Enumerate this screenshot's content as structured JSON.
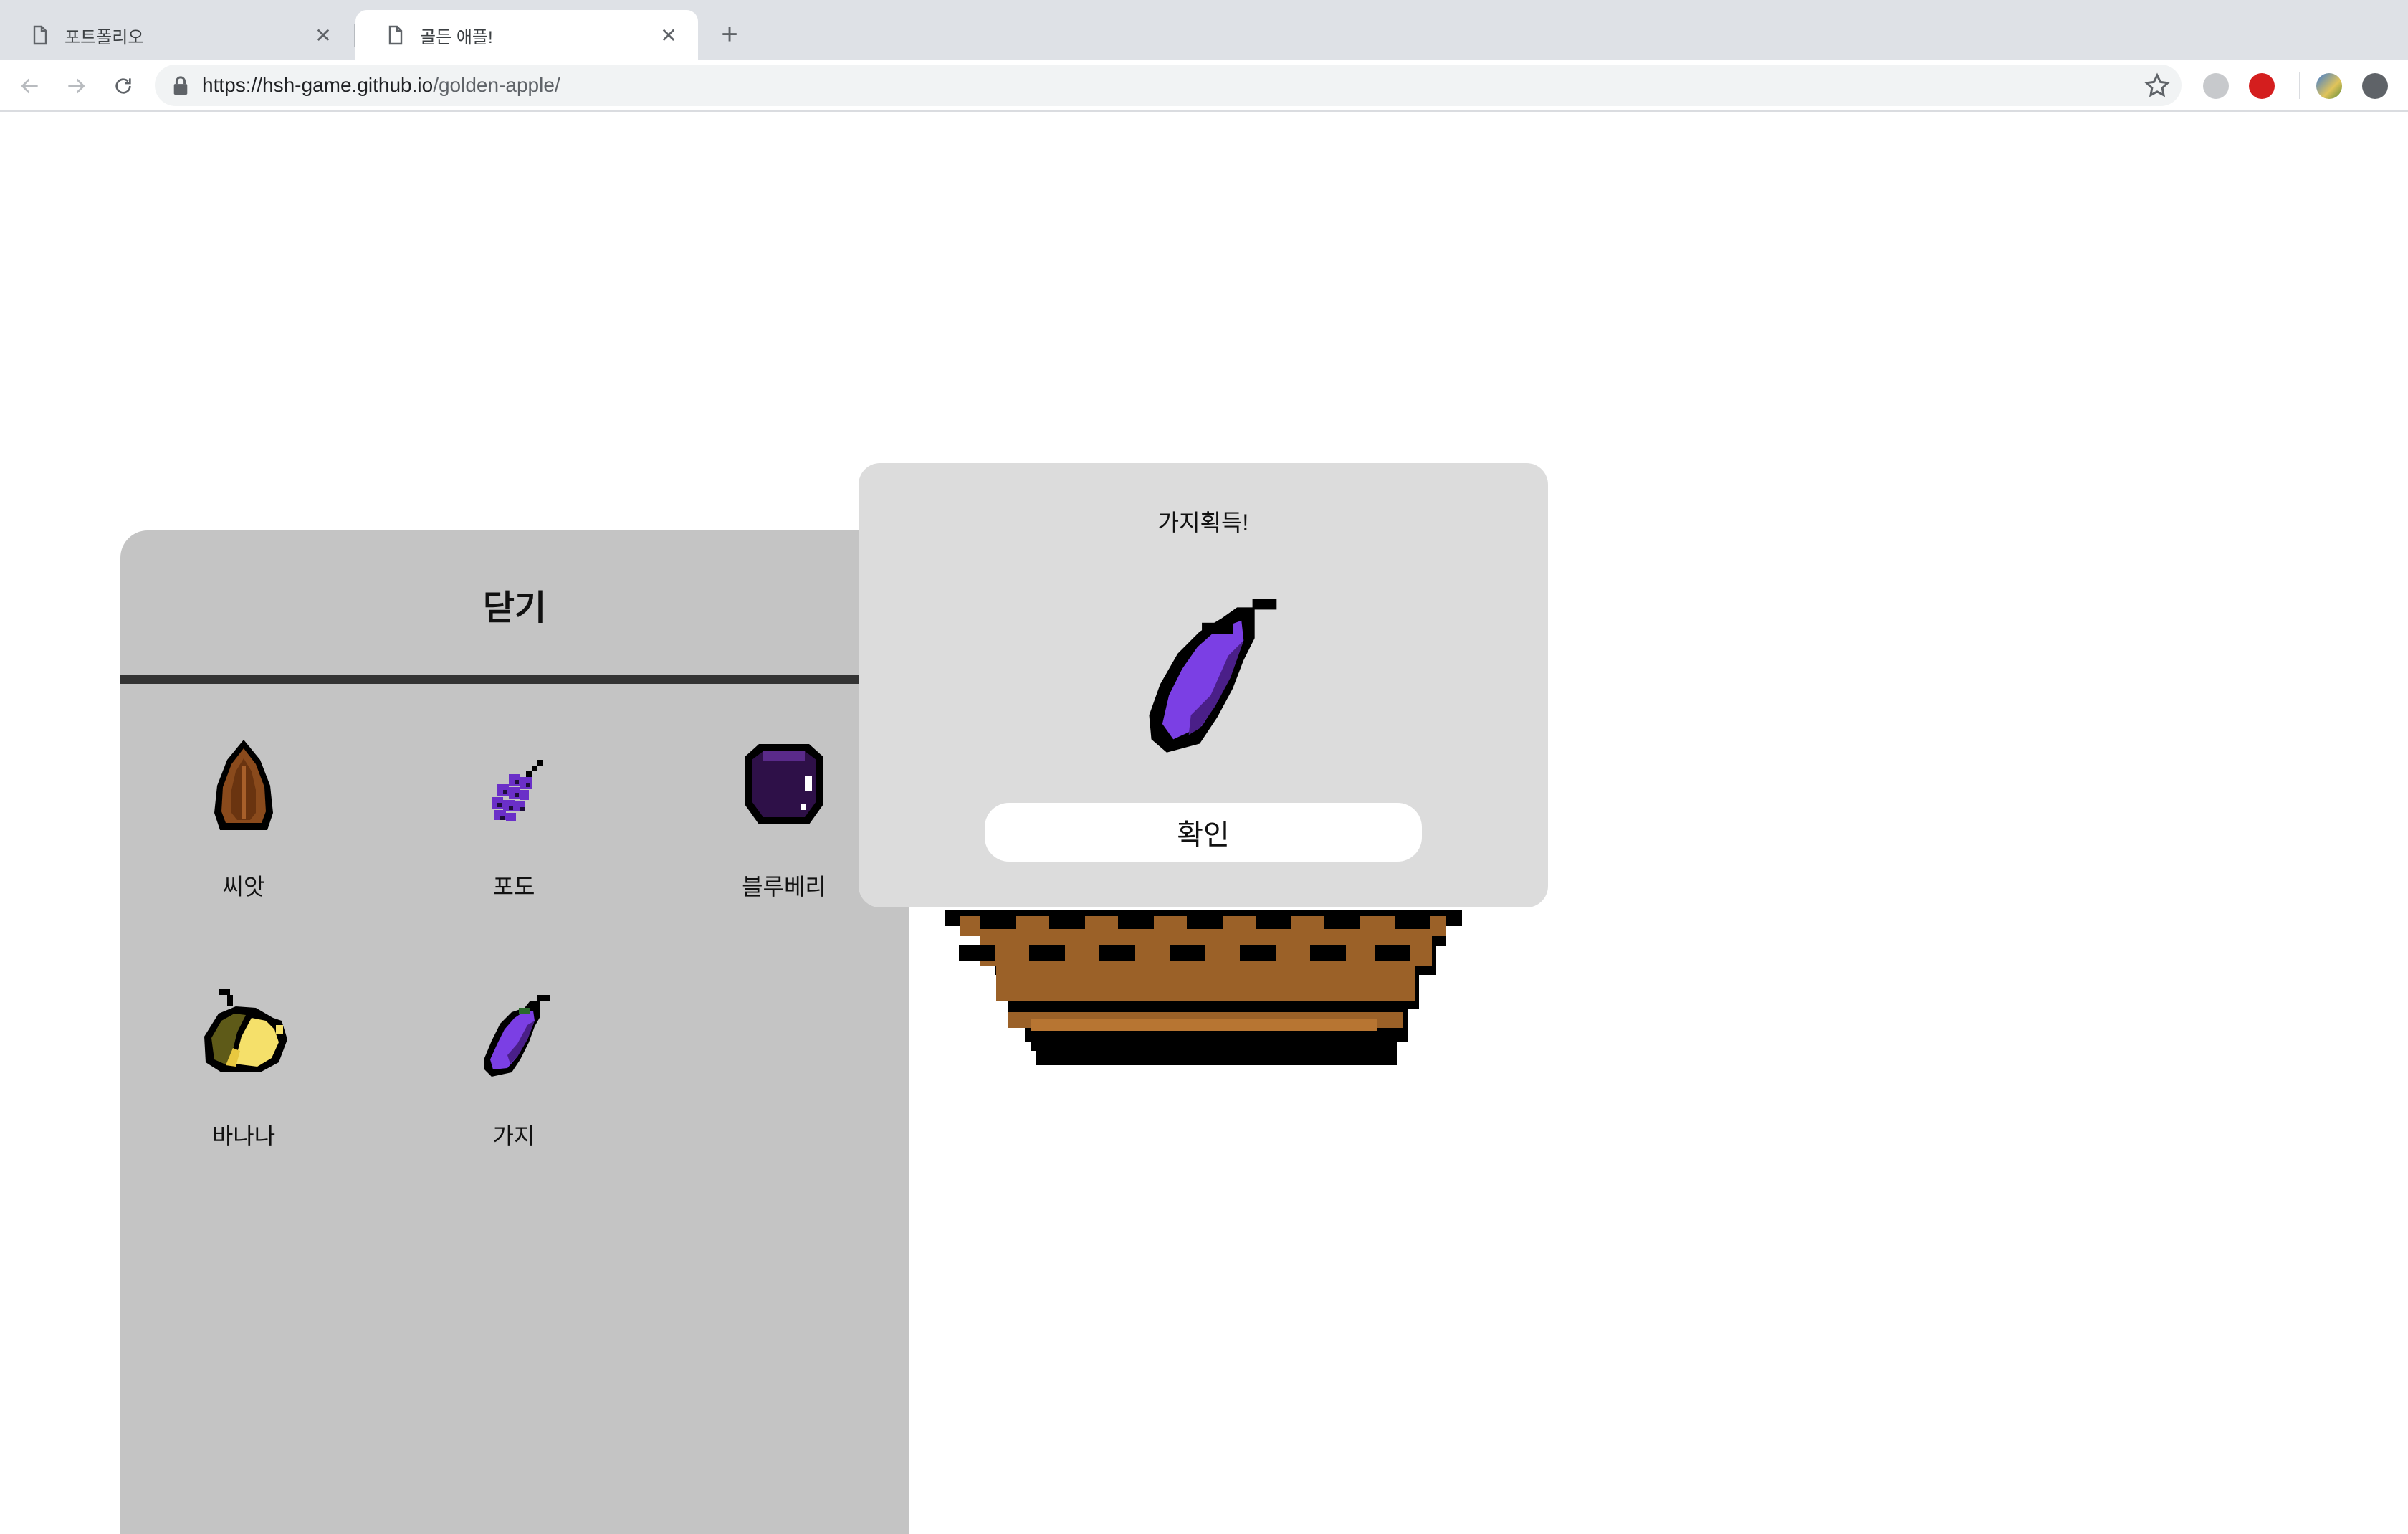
{
  "browser": {
    "tabs": [
      {
        "title": "포트폴리오",
        "active": false
      },
      {
        "title": "골든 애플!",
        "active": true
      }
    ],
    "url": {
      "host": "https://hsh-game.github.io",
      "path": "/golden-apple/"
    }
  },
  "collection": {
    "close_label": "닫기",
    "items": [
      {
        "name": "씨앗",
        "icon": "seed-icon"
      },
      {
        "name": "포도",
        "icon": "grape-icon"
      },
      {
        "name": "블루베리",
        "icon": "blueberry-icon"
      },
      {
        "name": "바나나",
        "icon": "banana-icon"
      },
      {
        "name": "가지",
        "icon": "eggplant-icon"
      }
    ]
  },
  "modal": {
    "message": "가지획득!",
    "icon": "eggplant-icon",
    "confirm_label": "확인"
  },
  "colors": {
    "panel_bg": "#c4c4c4",
    "modal_bg": "#dcdcdc",
    "eggplant": "#7b3fe4",
    "basket": "#9b6128"
  }
}
